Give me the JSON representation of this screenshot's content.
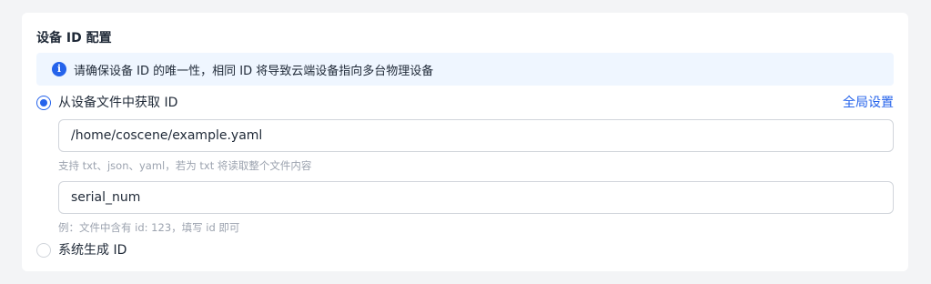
{
  "section": {
    "title": "设备 ID 配置"
  },
  "notice": {
    "icon": "info-icon",
    "icon_glyph": "i",
    "text": "请确保设备 ID 的唯一性，相同 ID 将导致云端设备指向多台物理设备"
  },
  "options": {
    "from_file": {
      "label": "从设备文件中获取 ID",
      "selected": true
    },
    "system_generated": {
      "label": "系统生成 ID",
      "selected": false
    }
  },
  "global_settings_link": "全局设置",
  "file_path": {
    "value": "/home/coscene/example.yaml",
    "hint": "支持 txt、json、yaml，若为 txt 将读取整个文件内容"
  },
  "id_field": {
    "value": "serial_num",
    "hint": "例：文件中含有 id: 123，填写 id 即可"
  },
  "colors": {
    "accent": "#2563eb",
    "notice_bg": "#eff6ff",
    "page_bg": "#f3f4f6"
  }
}
